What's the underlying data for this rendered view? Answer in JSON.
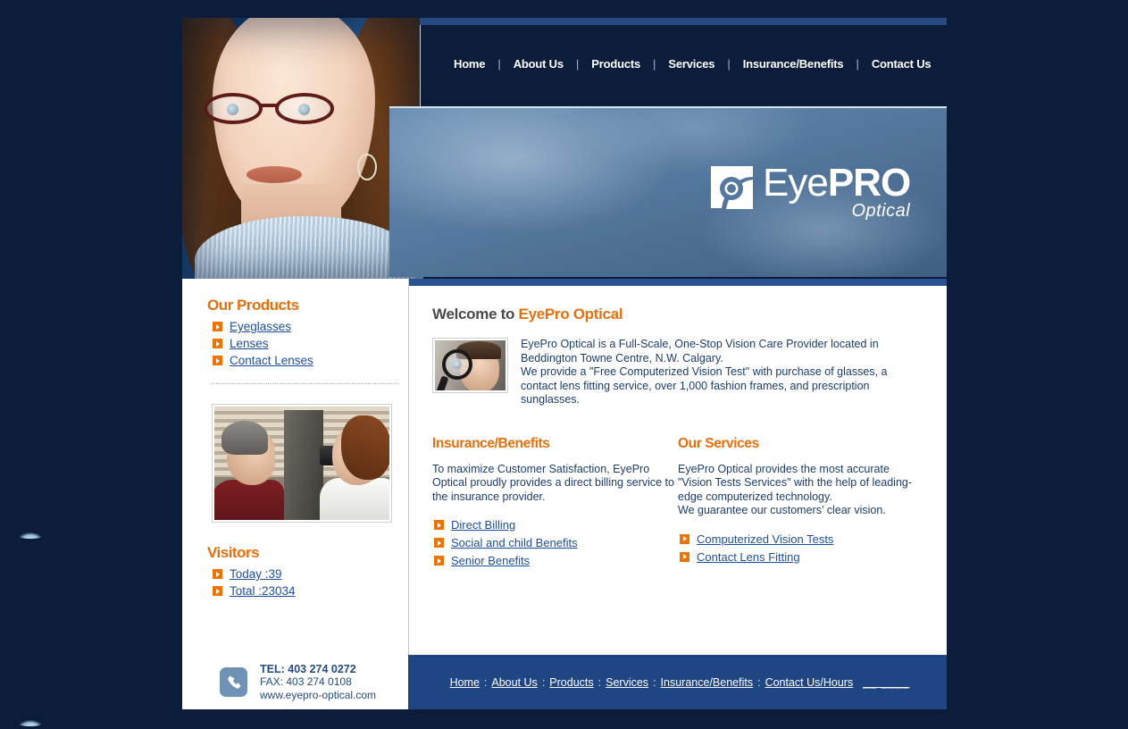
{
  "brand": {
    "name_light": "Eye",
    "name_bold": "PRO",
    "tagline": "Optical",
    "logo_icon": "eye-logo-icon"
  },
  "colors": {
    "page_bg": "#0b1d3a",
    "accent_orange": "#e4700e",
    "link_blue": "#20509c",
    "body_blue": "#1e3d6e",
    "footer_blue": "#1f4583",
    "content_topbar_blue": "#2a5192"
  },
  "nav": {
    "separator": "|",
    "items": [
      {
        "label": "Home"
      },
      {
        "label": "About Us"
      },
      {
        "label": "Products"
      },
      {
        "label": "Services"
      },
      {
        "label": "Insurance/Benefits"
      },
      {
        "label": "Contact Us"
      }
    ]
  },
  "sidebar": {
    "products": {
      "heading": "Our Products",
      "links": [
        {
          "label": "Eyeglasses"
        },
        {
          "label": "Lenses"
        },
        {
          "label": "Contact Lenses"
        }
      ]
    },
    "photo_alt": "eye-exam-photo",
    "visitors": {
      "heading": "Visitors",
      "links": [
        {
          "label": "Today :39"
        },
        {
          "label": "Total :23034"
        }
      ]
    }
  },
  "main": {
    "welcome": {
      "prefix": "Welcome to ",
      "brand": "EyePro Optical"
    },
    "intro": {
      "photo_alt": "magnifier-eye-photo",
      "paragraph": "EyePro Optical is a Full-Scale, One-Stop Vision Care Provider located in Beddington Towne Centre, N.W. Calgary.\nWe provide a \"Free Computerized Vision Test\" with purchase of glasses, a contact lens fitting service, over 1,000 fashion frames, and prescription sunglasses."
    },
    "columns": [
      {
        "heading": "Insurance/Benefits",
        "body": "To maximize Customer Satisfaction, EyePro Optical proudly provides a direct billing service to the insurance provider.",
        "links": [
          {
            "label": "Direct Billing"
          },
          {
            "label": "Social and child Benefits"
          },
          {
            "label": "Senior Benefits"
          }
        ]
      },
      {
        "heading": "Our Services",
        "body": "EyePro Optical provides the most accurate \"Vision Tests Services\" with the help of leading-edge computerized technology.\nWe guarantee our customers’ clear vision.",
        "links": [
          {
            "label": "Computerized Vision Tests"
          },
          {
            "label": "Contact Lens Fitting"
          }
        ]
      }
    ]
  },
  "footer": {
    "phone_icon": "phone-icon",
    "tel": "TEL: 403 274 0272",
    "fax": "FAX: 403 274 0108",
    "website": "www.eyepro-optical.com",
    "separator": ":",
    "links": [
      {
        "label": "Home"
      },
      {
        "label": "About Us"
      },
      {
        "label": "Products"
      },
      {
        "label": "Services"
      },
      {
        "label": "Insurance/Benefits"
      },
      {
        "label": "Contact Us/Hours"
      }
    ],
    "trailing": "__  ____"
  }
}
